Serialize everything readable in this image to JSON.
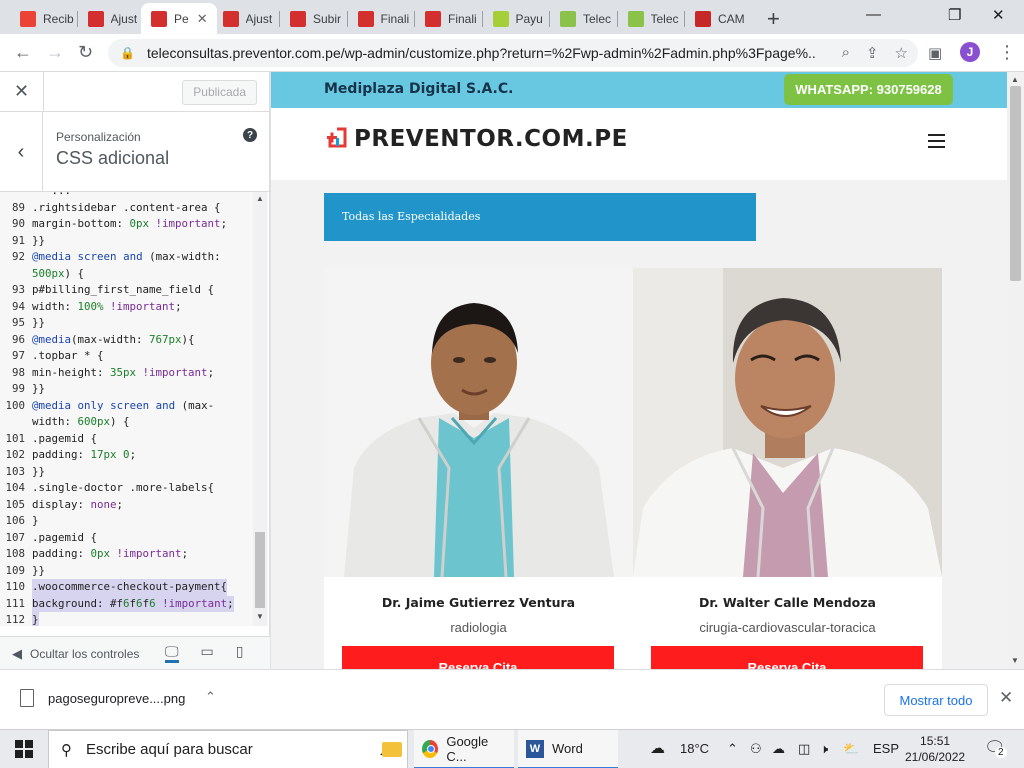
{
  "tabs": [
    {
      "title": "Recib",
      "icon": "gmail-icon",
      "color": "#ea4335"
    },
    {
      "title": "Ajust",
      "icon": "preventor-icon",
      "color": "#d32f2f"
    },
    {
      "title": "Pe",
      "icon": "preventor-icon",
      "color": "#d32f2f",
      "active": true
    },
    {
      "title": "Ajust",
      "icon": "preventor-icon",
      "color": "#d32f2f"
    },
    {
      "title": "Subir",
      "icon": "preventor-icon",
      "color": "#d32f2f"
    },
    {
      "title": "Finali",
      "icon": "preventor-icon",
      "color": "#d32f2f"
    },
    {
      "title": "Finali",
      "icon": "preventor-icon",
      "color": "#d32f2f"
    },
    {
      "title": "Payu",
      "icon": "payu-icon",
      "color": "#a6ce39"
    },
    {
      "title": "Telec",
      "icon": "plus-cross-icon",
      "color": "#8bc34a"
    },
    {
      "title": "Telec",
      "icon": "plus-cross-icon",
      "color": "#8bc34a"
    },
    {
      "title": "CAM",
      "icon": "cam-icon",
      "color": "#c62828"
    }
  ],
  "address": {
    "url": "teleconsultas.preventor.com.pe/wp-admin/customize.php?return=%2Fwp-admin%2Fadmin.php%3Fpage%...",
    "avatar_letter": "J"
  },
  "customizer": {
    "publish_label": "Publicada",
    "crumb": "Personalización",
    "section_title": "CSS adicional",
    "hide_controls_label": "Ocultar los controles",
    "code_lines": [
      {
        "n": "",
        "t": "   ..."
      },
      {
        "n": "89",
        "t": ".rightsidebar .content-area {"
      },
      {
        "n": "90",
        "t": "margin-bottom: 0px !important;"
      },
      {
        "n": "91",
        "t": "}}"
      },
      {
        "n": "92",
        "t": "@media screen and (max-width:"
      },
      {
        "n": "",
        "t": "500px) {"
      },
      {
        "n": "93",
        "t": "p#billing_first_name_field {"
      },
      {
        "n": "94",
        "t": "width: 100% !important;"
      },
      {
        "n": "95",
        "t": "}}"
      },
      {
        "n": "96",
        "t": "@media(max-width: 767px){"
      },
      {
        "n": "97",
        "t": ".topbar * {"
      },
      {
        "n": "98",
        "t": "min-height: 35px !important;"
      },
      {
        "n": "99",
        "t": "}}"
      },
      {
        "n": "100",
        "t": "@media only screen and (max-"
      },
      {
        "n": "",
        "t": "width: 600px) {"
      },
      {
        "n": "101",
        "t": ".pagemid {"
      },
      {
        "n": "102",
        "t": "padding: 17px 0;"
      },
      {
        "n": "103",
        "t": "}}"
      },
      {
        "n": "104",
        "t": ".single-doctor .more-labels{"
      },
      {
        "n": "105",
        "t": "display: none;"
      },
      {
        "n": "106",
        "t": "}"
      },
      {
        "n": "107",
        "t": ".pagemid {"
      },
      {
        "n": "108",
        "t": "padding: 0px !important;"
      },
      {
        "n": "109",
        "t": "}}"
      },
      {
        "n": "110",
        "t": ".woocommerce-checkout-payment{",
        "sel": true
      },
      {
        "n": "111",
        "t": "background: #f6f6f6 !important;",
        "sel": true
      },
      {
        "n": "112",
        "t": "}",
        "sel": true
      }
    ]
  },
  "site": {
    "company": "Mediplaza Digital S.A.C.",
    "whatsapp": "WHATSAPP: 930759628",
    "logo_text": "PREVENTOR.COM.PE",
    "specialties_label": "Todas las Especialidades",
    "doctors": [
      {
        "name": "Dr. Jaime Gutierrez Ventura",
        "specialty": "radiologia",
        "button": "Reserva Cita"
      },
      {
        "name": "Dr. Walter Calle Mendoza",
        "specialty": "cirugia-cardiovascular-toracica",
        "button": "Reserva Cita"
      }
    ]
  },
  "downloads": {
    "file_name": "pagoseguropreve....png",
    "show_all": "Mostrar todo"
  },
  "taskbar": {
    "search_placeholder": "Escribe aquí para buscar",
    "apps": [
      {
        "label": "Google C...",
        "icon": "chrome-icon"
      },
      {
        "label": "Word",
        "icon": "word-icon"
      }
    ],
    "weather": "18°C",
    "language": "ESP",
    "time": "15:51",
    "date": "21/06/2022",
    "notifications": "2"
  },
  "colors": {
    "topbar": "#69c8e1",
    "whatsapp": "#7dc242",
    "specialties": "#2195c9",
    "reserve": "#ff1c1c",
    "logo_red": "#e53935"
  }
}
